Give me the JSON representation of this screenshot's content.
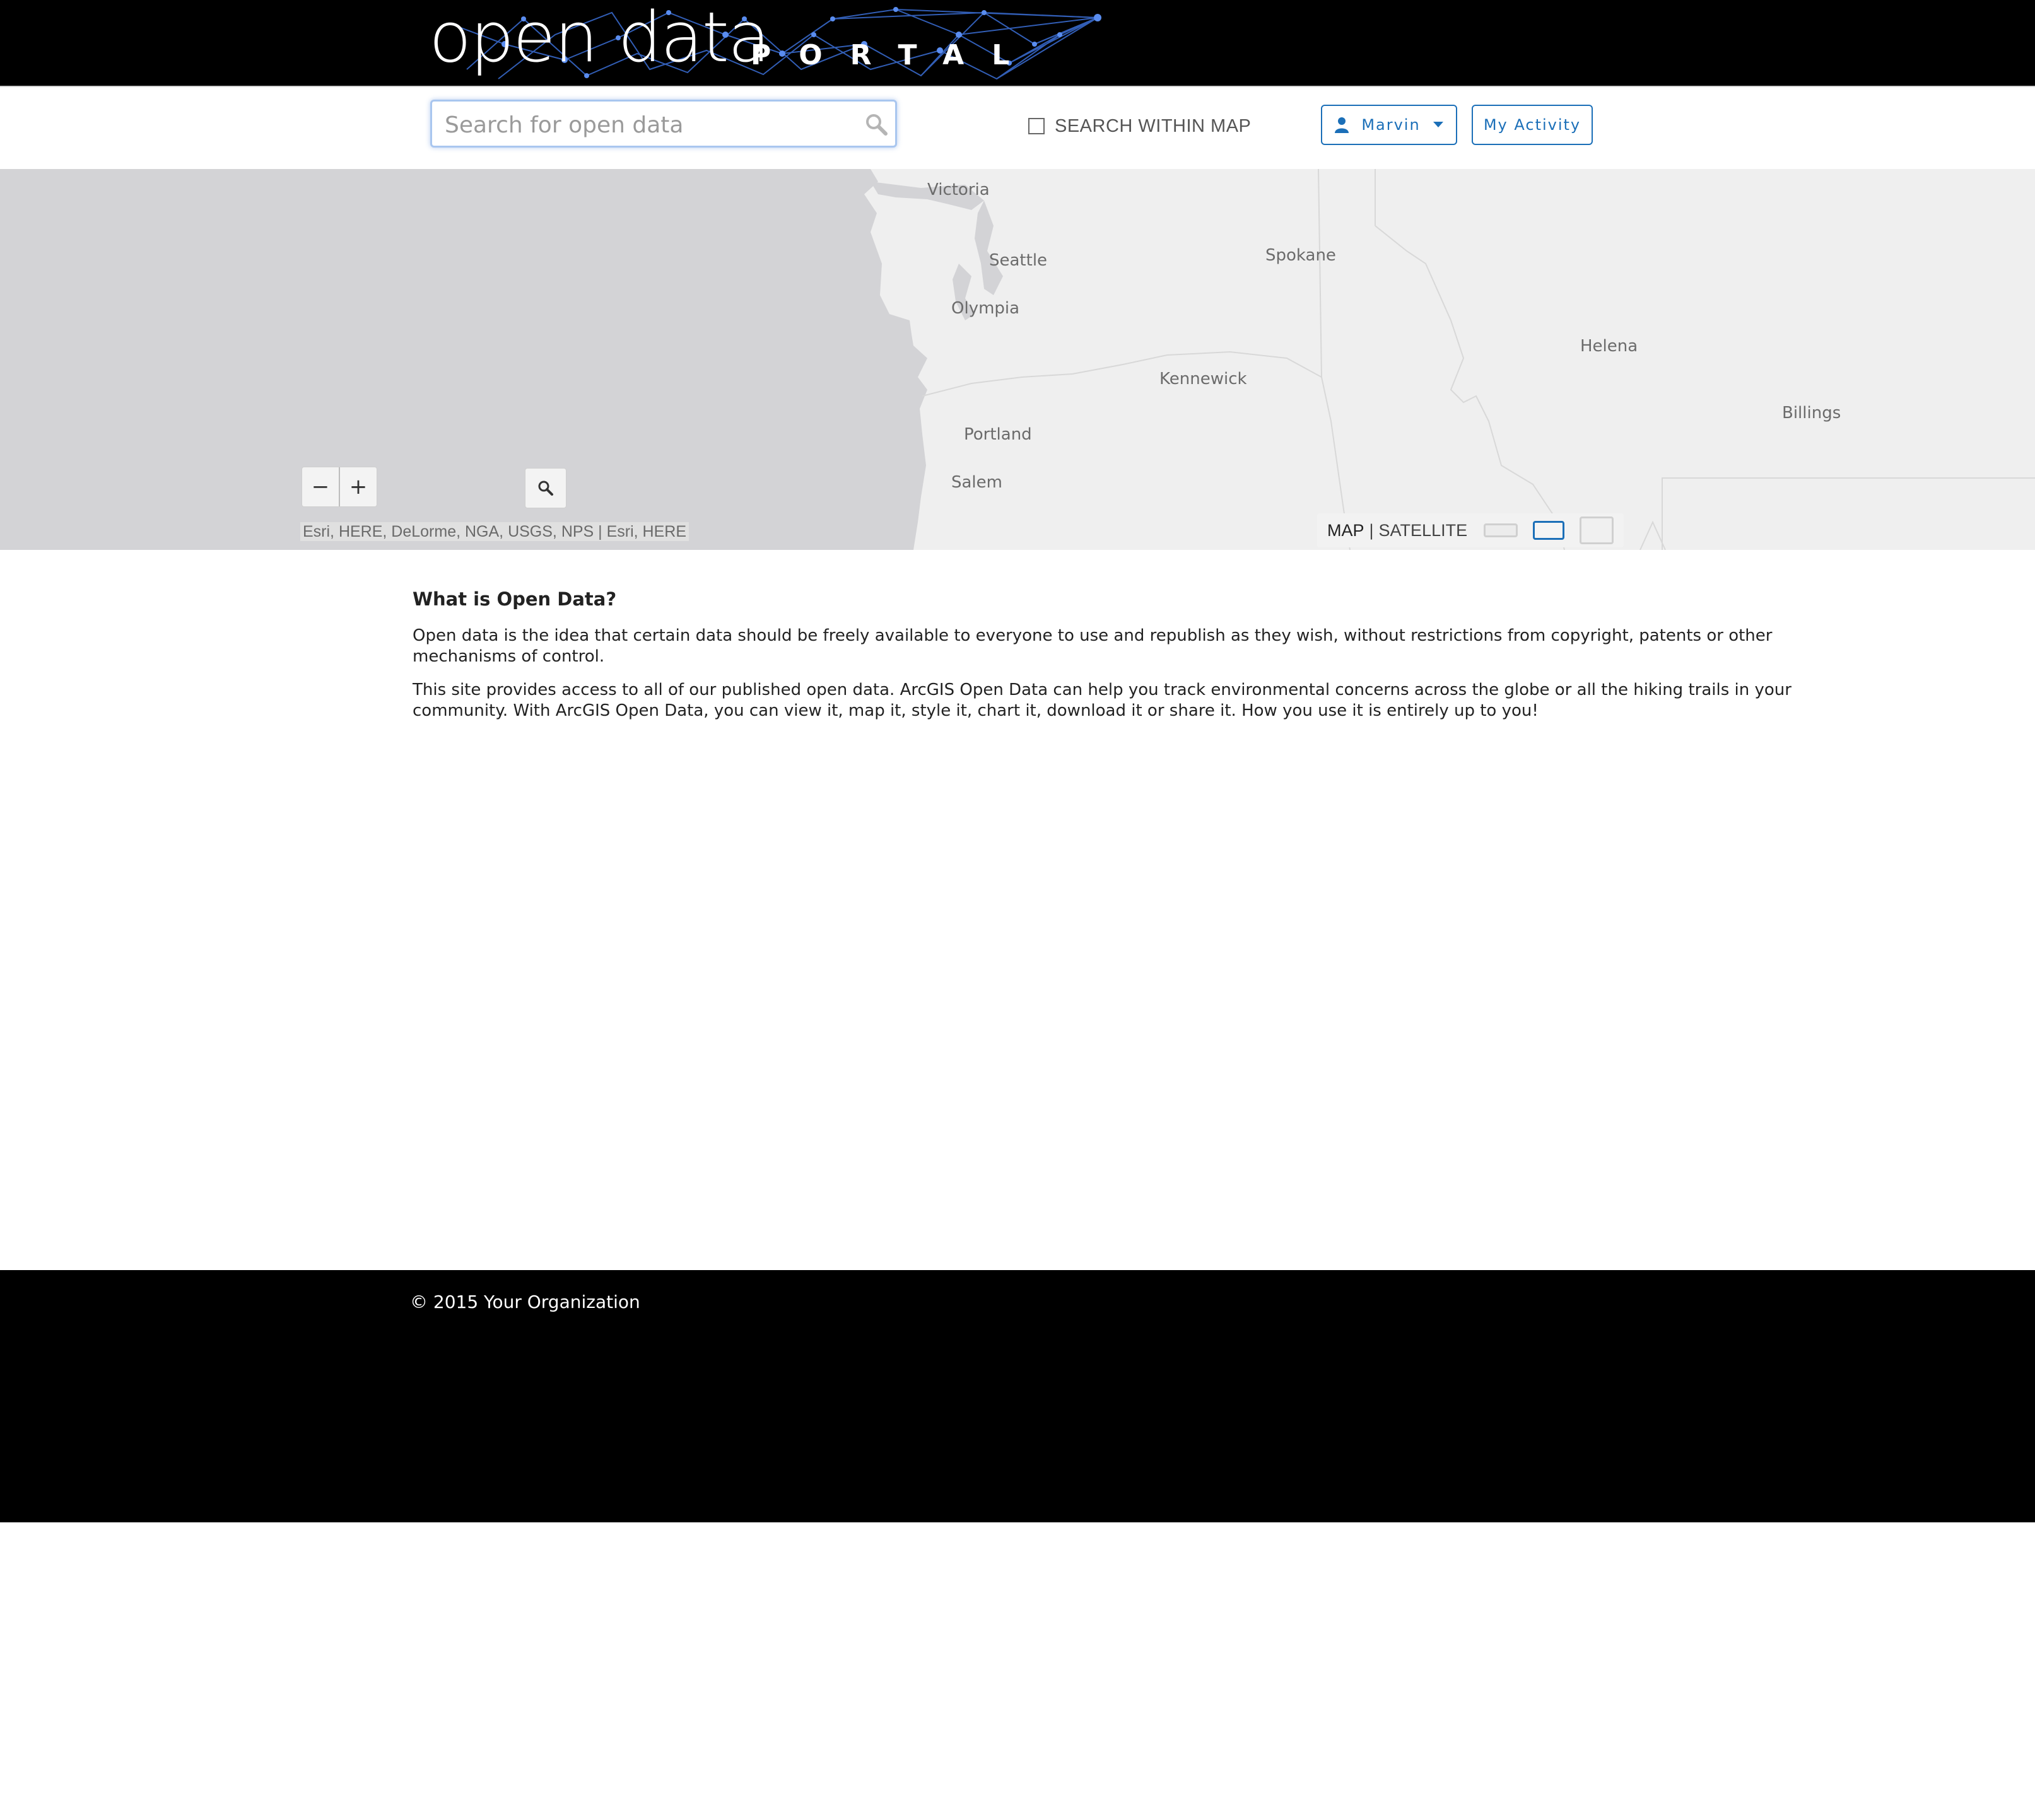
{
  "header": {
    "logo_text_main": "open data",
    "logo_text_sub": "PORTAL"
  },
  "toolbar": {
    "search_placeholder": "Search for open data",
    "search_within_map_label": "SEARCH WITHIN MAP",
    "search_within_map_checked": false,
    "user_menu_label": "Marvin",
    "my_activity_label": "My Activity",
    "accent_color": "#1b6fb8"
  },
  "map": {
    "cities": {
      "victoria": "Victoria",
      "seattle": "Seattle",
      "spokane": "Spokane",
      "olympia": "Olympia",
      "helena": "Helena",
      "kennewick": "Kennewick",
      "billings": "Billings",
      "portland": "Portland",
      "salem": "Salem"
    },
    "zoom_out_label": "−",
    "zoom_in_label": "+",
    "attribution": "Esri, HERE, DeLorme, NGA, USGS, NPS |  Esri, HERE",
    "basemap_map_label": "MAP",
    "basemap_separator": "|",
    "basemap_satellite_label": "SATELLITE",
    "selected_basemap": "MAP",
    "water_color": "#d3d3d6",
    "land_color": "#efefef"
  },
  "content": {
    "heading": "What is Open Data?",
    "paragraph_1": "Open data is the idea that certain data should be freely available to everyone to use and republish as they wish, without restrictions from copyright, patents or other mechanisms of control.",
    "paragraph_2": "This site provides access to all of our published open data. ArcGIS Open Data can help you track environmental concerns across the globe or all the hiking trails in your community. With ArcGIS Open Data, you can view it, map it, style it, chart it, download it or share it. How you use it is entirely up to you!"
  },
  "footer": {
    "copyright": "© 2015 Your Organization"
  }
}
